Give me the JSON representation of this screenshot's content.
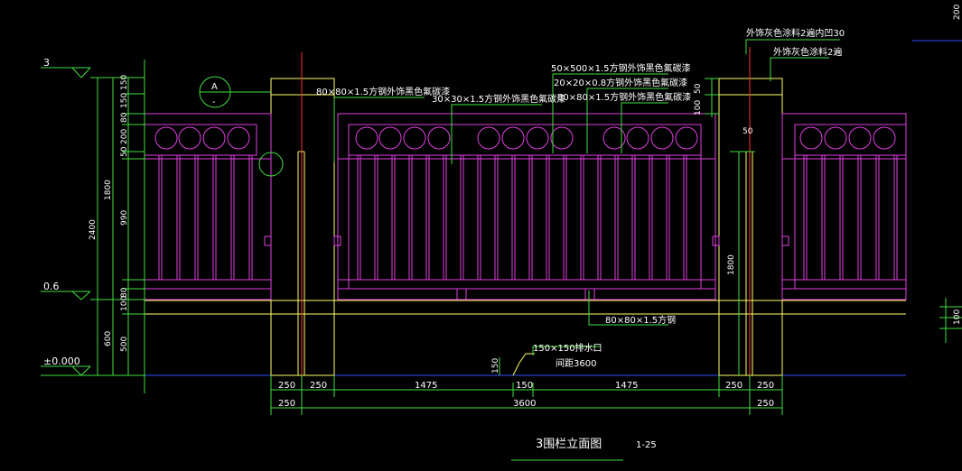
{
  "drawing": {
    "title": "3围栏立面图",
    "scale": "1-25",
    "bubble": {
      "top": "A",
      "bottom": "-"
    }
  },
  "levels": [
    "3",
    "0.6",
    "±0.000"
  ],
  "notes": [
    "外饰灰色涂料2遍内凹30",
    "外饰灰色涂料2遍",
    "50×500×1.5方钢外饰黑色氟碳漆",
    "20×20×0.8方钢外饰黑色氟碳漆",
    "80×80×1.5方钢外饰黑色氟碳漆",
    "80×80×1.5方钢外饰黑色氟碳漆",
    "30×30×1.5方钢外饰黑色氟碳漆",
    "80×80×1.5方钢",
    "150×150排水口",
    "间距3600"
  ],
  "dims_left": [
    "150",
    "150",
    "80",
    "200",
    "50",
    "990",
    "80",
    "100",
    "500",
    "1800",
    "600",
    "2400"
  ],
  "dims_bottom": [
    "250",
    "250",
    "1475",
    "150",
    "1475",
    "250",
    "250"
  ],
  "dims_total": [
    "250",
    "3600",
    "250"
  ],
  "dims_misc": [
    "50",
    "100",
    "50",
    "1800",
    "150",
    "200",
    "100"
  ],
  "colors": {
    "background": "#000000",
    "line_yellow": "#ffff66",
    "line_magenta": "#e040e0",
    "line_green": "#40e040",
    "line_red": "#ff3030",
    "line_blue": "#3050ff",
    "text_white": "#ffffff"
  }
}
